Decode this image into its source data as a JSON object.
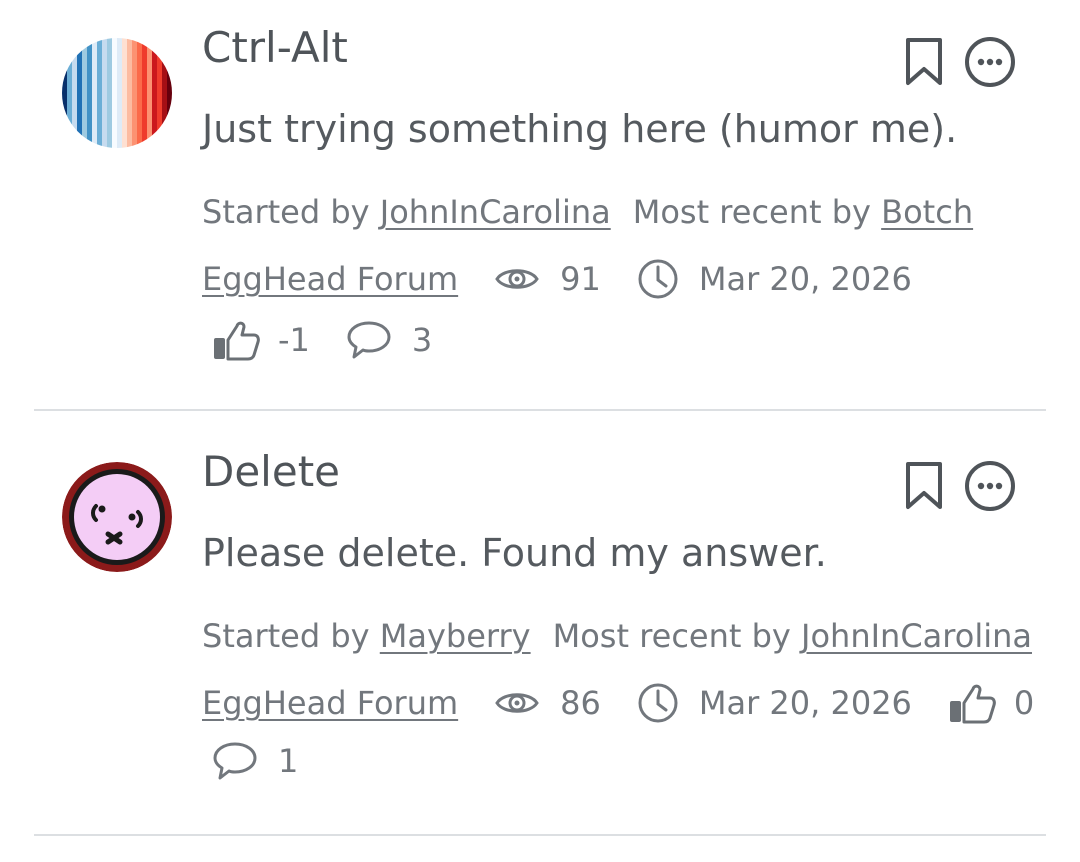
{
  "discussions": [
    {
      "title": "Ctrl-Alt",
      "excerpt": "Just trying something here (humor me).",
      "started_by_prefix": "Started by",
      "started_by_user": "JohnInCarolina",
      "recent_by_prefix": "Most recent by",
      "recent_by_user": "Botch",
      "category": "EggHead Forum",
      "views": "91",
      "date": "Mar 20, 2026",
      "score": "-1",
      "comments": "3",
      "avatar_icon": "warming-stripes-avatar"
    },
    {
      "title": "Delete",
      "excerpt": "Please delete. Found my answer.",
      "started_by_prefix": "Started by",
      "started_by_user": "Mayberry",
      "recent_by_prefix": "Most recent by",
      "recent_by_user": "JohnInCarolina",
      "category": "EggHead Forum",
      "views": "86",
      "date": "Mar 20, 2026",
      "score": "0",
      "comments": "1",
      "avatar_icon": "dizzy-face-avatar"
    }
  ],
  "icons": {
    "bookmark": "bookmark-icon",
    "options": "more-options-icon",
    "views": "eye-icon",
    "date": "clock-icon",
    "score": "thumbs-up-icon",
    "comments": "speech-bubble-icon"
  },
  "colors": {
    "text": "#555a5f",
    "meta_text": "#72777d",
    "icon": "#4f5459",
    "divider": "#dcdfe2"
  }
}
